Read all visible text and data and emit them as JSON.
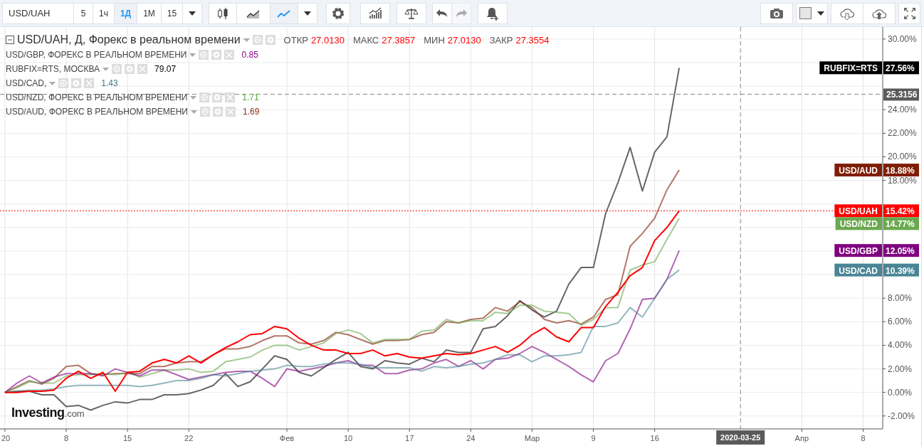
{
  "toolbar": {
    "symbol": "USD/UAH",
    "intervals": [
      {
        "label": "5",
        "selected": false
      },
      {
        "label": "1ч",
        "selected": false
      },
      {
        "label": "1Д",
        "selected": true
      },
      {
        "label": "1М",
        "selected": false
      },
      {
        "label": "15",
        "selected": false
      }
    ],
    "chart_types": [
      {
        "kind": "candles",
        "selected": false
      },
      {
        "kind": "area",
        "selected": false
      },
      {
        "kind": "line",
        "selected": true
      }
    ],
    "tools": [
      {
        "kind": "settings",
        "disabled": false
      },
      {
        "kind": "indicators",
        "disabled": false
      },
      {
        "kind": "compare",
        "disabled": false
      },
      {
        "kind": "undo",
        "disabled": false
      },
      {
        "kind": "redo",
        "disabled": true
      },
      {
        "kind": "alert",
        "disabled": false
      }
    ],
    "right_tools": [
      {
        "kind": "camera"
      },
      {
        "kind": "color"
      },
      {
        "kind": "download"
      },
      {
        "kind": "upload"
      },
      {
        "kind": "fullscreen"
      }
    ]
  },
  "legend": {
    "main": {
      "title": "USD/UAH, Д, Форекс в реальном времени",
      "stats": [
        {
          "label": "ОТКР",
          "value": "27.0130"
        },
        {
          "label": "МАКС",
          "value": "27.3857"
        },
        {
          "label": "МИН",
          "value": "27.0130"
        },
        {
          "label": "ЗАКР",
          "value": "27.3554"
        }
      ]
    },
    "rows": [
      {
        "name": "USD/GBP, ФОРЕКС В РЕАЛЬНОМ ВРЕМЕНИ",
        "value": "0.85",
        "color": "#8b008b"
      },
      {
        "name": "RUBFIX=RTS, МОСКВА",
        "value": "79.07",
        "color": "#000000"
      },
      {
        "name": "USD/CAD,",
        "value": "1.43",
        "color": "#3d7a8a"
      },
      {
        "name": "USD/NZD, ФОРЕКС В РЕАЛЬНОМ ВРЕМЕНИ",
        "value": "1.71",
        "color": "#5aa83a"
      },
      {
        "name": "USD/AUD, ФОРЕКС В РЕАЛЬНОМ ВРЕМЕНИ",
        "value": "1.69",
        "color": "#8b2d1a"
      }
    ]
  },
  "chart": {
    "chart_data": {
      "type": "line",
      "grid": true,
      "legend": "right",
      "categories": [
        "20",
        null,
        null,
        null,
        null,
        "8",
        null,
        null,
        null,
        null,
        "15",
        null,
        null,
        null,
        null,
        "22",
        null,
        null,
        null,
        null,
        null,
        null,
        null,
        "Фев",
        null,
        null,
        null,
        null,
        "10",
        null,
        null,
        null,
        null,
        "17",
        null,
        null,
        null,
        null,
        "24",
        null,
        null,
        null,
        null,
        "Мар",
        null,
        null,
        null,
        null,
        "9",
        null,
        null,
        null,
        null,
        "16",
        null,
        null,
        null,
        null,
        null,
        null,
        null,
        null,
        null,
        null,
        null,
        "Апр",
        null,
        null,
        null,
        null,
        "8",
        null
      ],
      "ylim": [
        -3.1,
        30.9
      ],
      "yticks": [
        {
          "value": -2,
          "label": "-2.00%"
        },
        {
          "value": 0,
          "label": "0.00%"
        },
        {
          "value": 2,
          "label": "2.00%"
        },
        {
          "value": 4,
          "label": "4.00%"
        },
        {
          "value": 6,
          "label": "6.00%"
        },
        {
          "value": 8,
          "label": "8.00%"
        },
        {
          "value": 18,
          "label": "18.00%"
        },
        {
          "value": 20,
          "label": "20.00%"
        },
        {
          "value": 22,
          "label": "22.00%"
        },
        {
          "value": 24,
          "label": "24.00%"
        },
        {
          "value": 30,
          "label": "30.00%"
        }
      ],
      "series": [
        {
          "name": "RUBFIX=RTS",
          "color": "#000000",
          "values": [
            0,
            0.1,
            0.1,
            -0.2,
            -0.2,
            -1.2,
            -1.1,
            -1.5,
            -1.1,
            -0.8,
            -0.9,
            -0.6,
            -0.6,
            -0.2,
            -0.2,
            -0.1,
            0.2,
            0.6,
            1.6,
            0.5,
            0.9,
            2.0,
            3.1,
            2.8,
            1.7,
            1.4,
            2.1,
            2.8,
            3.4,
            2.2,
            2.0,
            2.7,
            2.5,
            2.4,
            2.9,
            2.6,
            3.6,
            3.4,
            3.4,
            5.4,
            5.6,
            6.5,
            7.8,
            7.0,
            6.4,
            6.9,
            9.2,
            10.6,
            10.6,
            15.2,
            17.8,
            20.8,
            17.1,
            20.4,
            21.7,
            27.56,
            null,
            null,
            null,
            null,
            null,
            null,
            null,
            null,
            null,
            null,
            null,
            null,
            null,
            null,
            null,
            null
          ]
        },
        {
          "name": "USD/AUD",
          "color": "#7f1e05",
          "values": [
            0,
            0.5,
            1.0,
            0.7,
            1.2,
            2.2,
            2.3,
            1.6,
            1.5,
            1.6,
            1.6,
            1.6,
            2.2,
            2.2,
            2.5,
            2.6,
            2.6,
            3.2,
            3.7,
            3.7,
            3.9,
            4.4,
            4.8,
            4.8,
            4.2,
            4.1,
            4.4,
            5.1,
            4.9,
            4.5,
            4.1,
            4.4,
            4.4,
            4.5,
            4.9,
            5.1,
            6.0,
            5.9,
            6.2,
            6.3,
            7.2,
            6.9,
            7.7,
            7.2,
            6.2,
            5.9,
            6.1,
            5.8,
            6.4,
            7.9,
            8.3,
            12.4,
            13.5,
            14.8,
            17.2,
            18.88,
            null,
            null,
            null,
            null,
            null,
            null,
            null,
            null,
            null,
            null,
            null,
            null,
            null,
            null,
            null,
            null
          ]
        },
        {
          "name": "USD/UAH",
          "color": "#ff0000",
          "values": [
            0,
            0,
            0.1,
            0.1,
            0.2,
            1.2,
            1.8,
            1.2,
            1.7,
            0.1,
            1.7,
            1.8,
            2.5,
            2.8,
            2.5,
            3.1,
            2.5,
            3.2,
            3.8,
            4.3,
            4.9,
            5.0,
            5.6,
            5.4,
            4.6,
            4.0,
            3.6,
            3.6,
            3.3,
            3.3,
            3.6,
            3.1,
            3.3,
            3.0,
            2.9,
            3.1,
            3.3,
            3.2,
            3.3,
            3.6,
            3.9,
            3.4,
            4.0,
            4.9,
            5.5,
            4.7,
            4.3,
            5.5,
            5.5,
            7.3,
            8.5,
            9.9,
            10.6,
            12.9,
            14.0,
            15.42,
            null,
            null,
            null,
            null,
            null,
            null,
            null,
            null,
            null,
            null,
            null,
            null,
            null,
            null,
            null,
            null
          ]
        },
        {
          "name": "USD/NZD",
          "color": "#6aa84f",
          "values": [
            0,
            0.4,
            0.9,
            0.8,
            0.8,
            1.4,
            1.5,
            1.5,
            1.6,
            1.5,
            1.7,
            1.3,
            1.6,
            1.9,
            1.9,
            2.0,
            1.7,
            1.8,
            2.6,
            2.8,
            3.0,
            3.6,
            4.0,
            4.0,
            3.6,
            3.9,
            4.2,
            5.0,
            5.3,
            5.0,
            4.2,
            4.5,
            4.5,
            4.5,
            5.2,
            5.3,
            6.2,
            5.9,
            6.1,
            6.1,
            6.8,
            6.7,
            7.4,
            7.4,
            6.9,
            6.8,
            6.7,
            5.7,
            6.2,
            7.2,
            7.2,
            10.4,
            10.8,
            11.1,
            13.0,
            14.77,
            null,
            null,
            null,
            null,
            null,
            null,
            null,
            null,
            null,
            null,
            null,
            null,
            null,
            null,
            null,
            null
          ]
        },
        {
          "name": "USD/GBP",
          "color": "#800080",
          "values": [
            0,
            0.8,
            1.4,
            0.8,
            1.3,
            1.6,
            1.6,
            1.6,
            1.4,
            2.0,
            1.7,
            1.4,
            1.9,
            1.9,
            1.5,
            1.1,
            1.3,
            1.5,
            1.7,
            1.8,
            1.8,
            1.2,
            0.5,
            2.0,
            1.8,
            2.0,
            2.2,
            2.5,
            2.7,
            2.3,
            2.3,
            1.6,
            1.6,
            1.9,
            2.0,
            2.5,
            2.8,
            2.2,
            2.7,
            2.0,
            2.8,
            2.9,
            3.3,
            3.9,
            3.4,
            2.8,
            2.2,
            1.5,
            0.9,
            2.7,
            3.3,
            5.4,
            7.9,
            8.0,
            9.6,
            12.05,
            null,
            null,
            null,
            null,
            null,
            null,
            null,
            null,
            null,
            null,
            null,
            null,
            null,
            null,
            null,
            null
          ]
        },
        {
          "name": "USD/CAD",
          "color": "#4a8595",
          "values": [
            0,
            0.1,
            0.2,
            0.2,
            0.3,
            0.5,
            0.6,
            0.6,
            0.6,
            0.6,
            0.6,
            0.5,
            0.6,
            0.8,
            1.0,
            1.0,
            1.2,
            1.5,
            1.4,
            1.6,
            1.8,
            1.9,
            2.0,
            2.3,
            2.2,
            2.2,
            2.4,
            2.5,
            2.5,
            2.4,
            2.1,
            2.1,
            2.1,
            2.1,
            1.8,
            2.2,
            2.1,
            2.2,
            2.4,
            2.5,
            2.8,
            3.2,
            3.2,
            2.6,
            3.1,
            3.1,
            3.2,
            3.4,
            5.6,
            5.6,
            5.9,
            7.2,
            6.4,
            8.0,
            9.6,
            10.39,
            null,
            null,
            null,
            null,
            null,
            null,
            null,
            null,
            null,
            null,
            null,
            null,
            null,
            null,
            null,
            null
          ]
        }
      ],
      "ref_lines": [
        {
          "axis": "y",
          "value": 25.3156,
          "label": "25.3156"
        },
        {
          "axis": "y",
          "value": 15.42,
          "color": "#ff0000"
        }
      ]
    },
    "crosshair": {
      "date": "2020-03-25"
    },
    "price_tags": [
      {
        "value": "27.56%"
      },
      {
        "value": "18.88%"
      },
      {
        "value": "15.42%"
      },
      {
        "value": "14.77%"
      },
      {
        "value": "12.05%"
      },
      {
        "value": "10.39%"
      }
    ],
    "logo": {
      "name": "Investing",
      "suffix": ".com"
    }
  }
}
